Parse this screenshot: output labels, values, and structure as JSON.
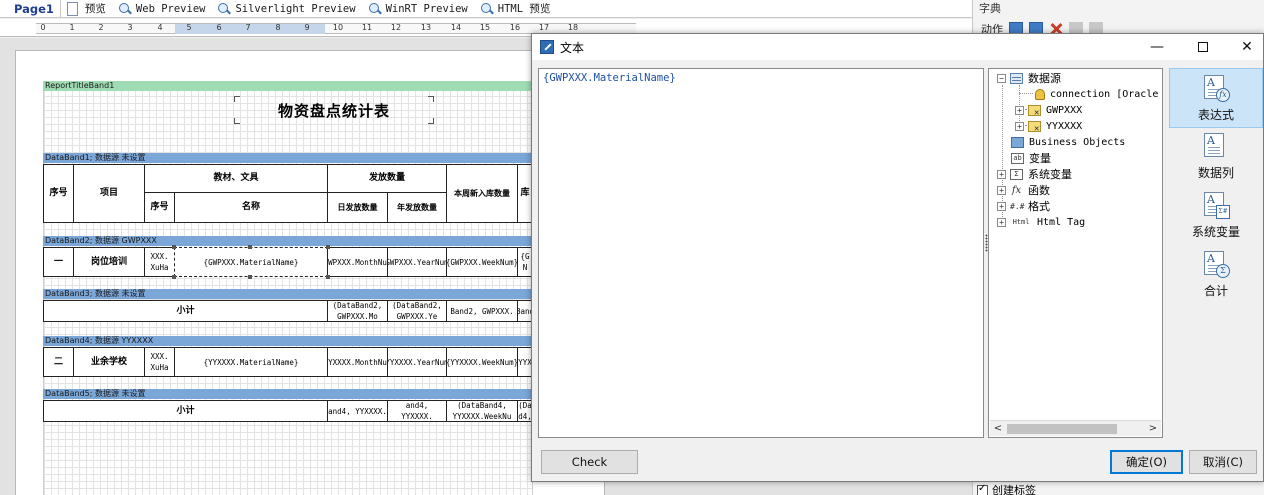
{
  "tabs": [
    {
      "label": "Page1",
      "active": true
    },
    {
      "label": "预览"
    },
    {
      "label": "Web Preview"
    },
    {
      "label": "Silverlight Preview"
    },
    {
      "label": "WinRT Preview"
    },
    {
      "label": "HTML 预览"
    }
  ],
  "ruler": {
    "numbers": [
      "0",
      "1",
      "2",
      "3",
      "4",
      "5",
      "6",
      "7",
      "8",
      "9",
      "10",
      "11",
      "12",
      "13",
      "14",
      "15",
      "16",
      "17",
      "18"
    ]
  },
  "dictionary": {
    "title": "字典",
    "action_label": "动作",
    "create_label": "创建标签",
    "create_checked": true
  },
  "report": {
    "title_band": "ReportTitleBand1",
    "title": "物资盘点统计表",
    "band1": "DataBand1; 数据源 未设置",
    "band2": "DataBand2; 数据源 GWPXXX",
    "band3": "DataBand3; 数据源 未设置",
    "band4": "DataBand4; 数据源 YYXXXX",
    "band5": "DataBand5; 数据源 未设置",
    "header": {
      "seq": "序号",
      "item": "项目",
      "materials": "教材、文具",
      "distribution": "发放数量",
      "weekly_in": "本周新入库数量",
      "trunc": "库",
      "sub_seq": "序号",
      "name": "名称",
      "daily": "日发放数量",
      "yearly": "年发放数量"
    },
    "row2": {
      "num": "一",
      "item": "岗位培训",
      "xuha": "XXX. XuHa",
      "material": "{GWPXXX.MaterialName}",
      "month": "{GWPXXX.MonthNum}",
      "year": "{GWPXXX.YearNum}",
      "week": "{GWPXXX.WeekNum}",
      "trunc": "{G N"
    },
    "row3": {
      "label": "小计",
      "c1": "(DataBand2, GWPXXX.Mo",
      "c2": "(DataBand2, GWPXXX.Ye",
      "c3": "Band2, GWPXXX.",
      "c4": "Band"
    },
    "row4": {
      "num": "二",
      "item": "业余学校",
      "xuha": "XXX. XuHa",
      "material": "{YYXXXX.MaterialName}",
      "month": "{YYXXXX.MonthNum}",
      "year": "{YYXXXX.YearNum}",
      "week": "{YYXXXX.WeekNum}",
      "trunc": "YYX"
    },
    "row5": {
      "label": "小计",
      "c1": "and4, YYXXXX.",
      "c2": "and4, YYXXXX.",
      "c3": "(DataBand4, YYXXXX.WeekNu",
      "c4": "(Da d4,"
    }
  },
  "dialog": {
    "title": "文本",
    "expression": "{GWPXXX.MaterialName}",
    "tree": {
      "datasource": "数据源",
      "connection": "connection [Oracle",
      "gwpxxx": "GWPXXX",
      "yyxxxx": "YYXXXX",
      "business_objects": "Business Objects",
      "variables": "变量",
      "system_variables": "系统变量",
      "functions": "函数",
      "format": "格式",
      "html_tag": "Html Tag"
    },
    "side_buttons": [
      "表达式",
      "数据列",
      "系统变量",
      "合计"
    ],
    "check_label": "Check",
    "ok_label": "确定(O)",
    "cancel_label": "取消(C)"
  }
}
